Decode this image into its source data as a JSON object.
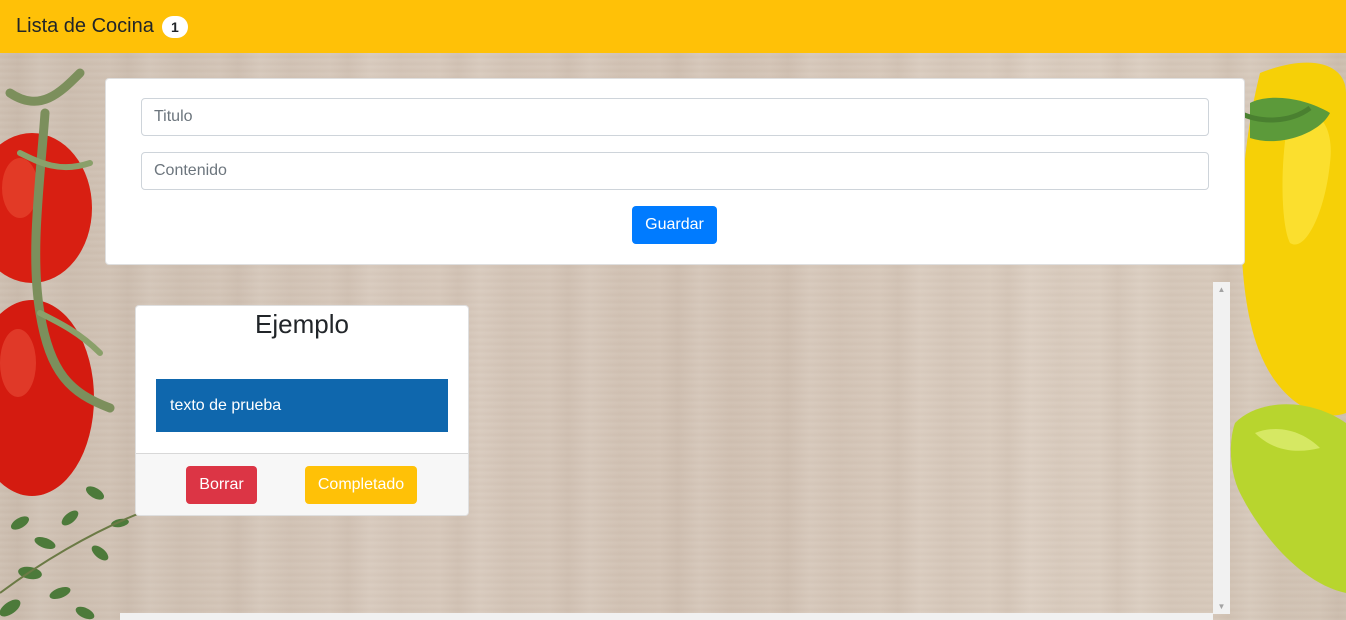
{
  "navbar": {
    "title": "Lista de Cocina",
    "badge_count": "1",
    "color": "#ffc107"
  },
  "form": {
    "title_placeholder": "Titulo",
    "content_placeholder": "Contenido",
    "save_label": "Guardar"
  },
  "notes": [
    {
      "title": "Ejemplo",
      "content": "texto de prueba",
      "delete_label": "Borrar",
      "complete_label": "Completado"
    }
  ],
  "colors": {
    "save_button": "#007bff",
    "delete_button": "#dc3545",
    "complete_button": "#ffc107",
    "note_body": "#0f67ad"
  },
  "icons": {
    "scroll_up": "scroll-up-arrow-icon",
    "scroll_down": "scroll-down-arrow-icon"
  }
}
